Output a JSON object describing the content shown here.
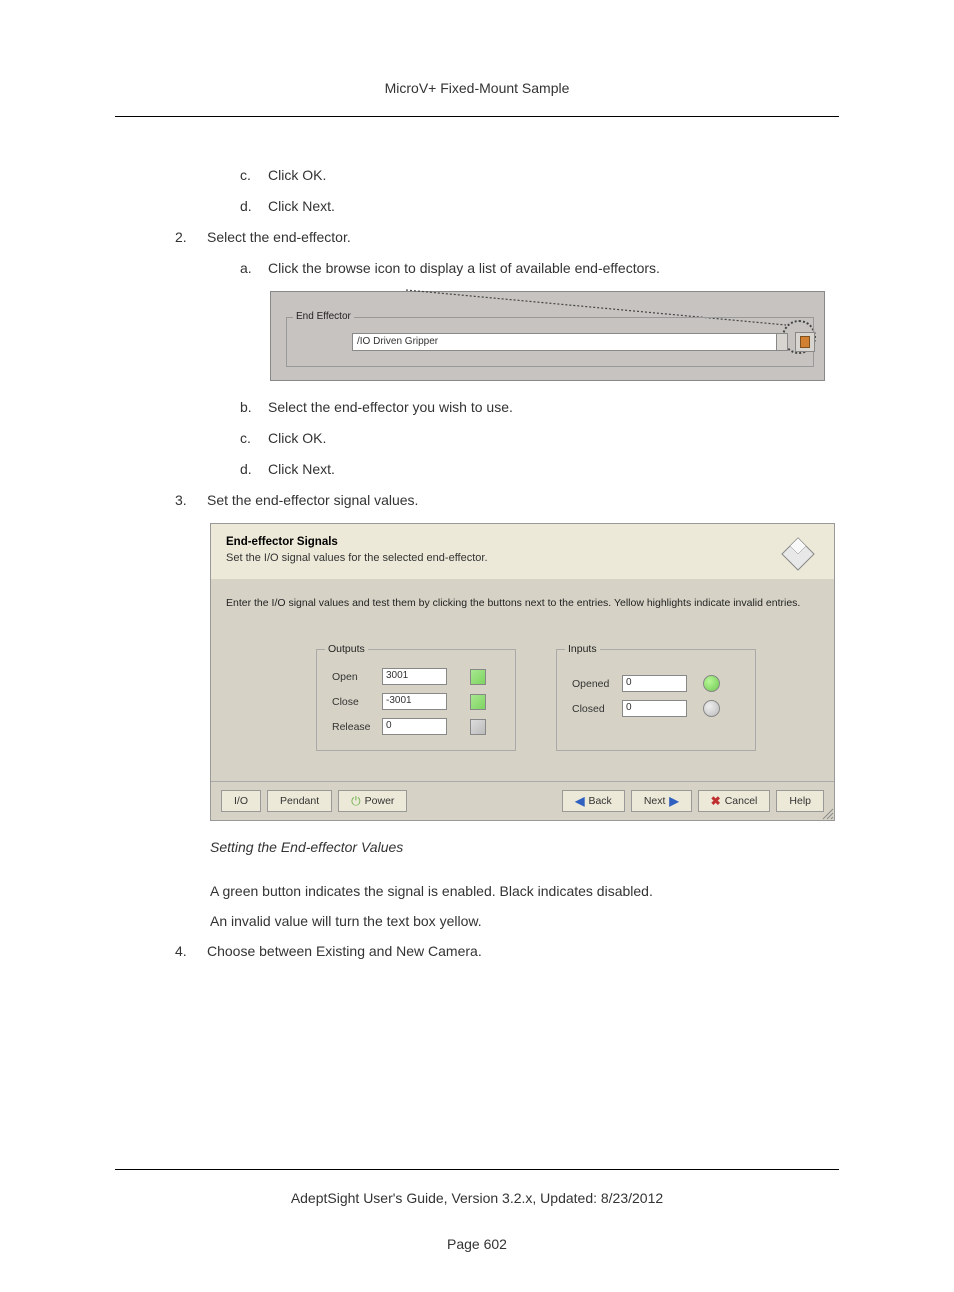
{
  "header": {
    "title": "MicroV+ Fixed-Mount Sample"
  },
  "steps": {
    "s1c": "Click OK.",
    "s1d": "Click Next.",
    "s2": "Select the end-effector.",
    "s2a": "Click the browse icon to display a list of available end-effectors.",
    "s2b": "Select the end-effector you wish to use.",
    "s2c": "Click OK.",
    "s2d": "Click Next.",
    "s3": "Set the end-effector signal values.",
    "s4": "Choose between Existing and New Camera."
  },
  "fig1": {
    "legend": "End Effector",
    "value": "/IO Driven Gripper"
  },
  "fig2": {
    "title": "End-effector Signals",
    "subtitle": "Set the I/O signal values for the selected end-effector.",
    "instruction": "Enter the I/O signal values and test them by clicking the buttons next to the entries.  Yellow highlights indicate invalid entries.",
    "outputs": {
      "legend": "Outputs",
      "open_label": "Open",
      "open_value": "3001",
      "close_label": "Close",
      "close_value": "-3001",
      "release_label": "Release",
      "release_value": "0"
    },
    "inputs": {
      "legend": "Inputs",
      "opened_label": "Opened",
      "opened_value": "0",
      "closed_label": "Closed",
      "closed_value": "0"
    },
    "buttons": {
      "io": "I/O",
      "pendant": "Pendant",
      "power": "Power",
      "back": "Back",
      "next": "Next",
      "cancel": "Cancel",
      "help": "Help"
    }
  },
  "caption": "Setting the End-effector Values",
  "para1": "A green button indicates the signal is enabled. Black indicates disabled.",
  "para2": "An invalid value will turn the text box yellow.",
  "footer": {
    "line": "AdeptSight User's Guide,  Version 3.2.x, Updated: 8/23/2012",
    "page": "Page 602"
  }
}
